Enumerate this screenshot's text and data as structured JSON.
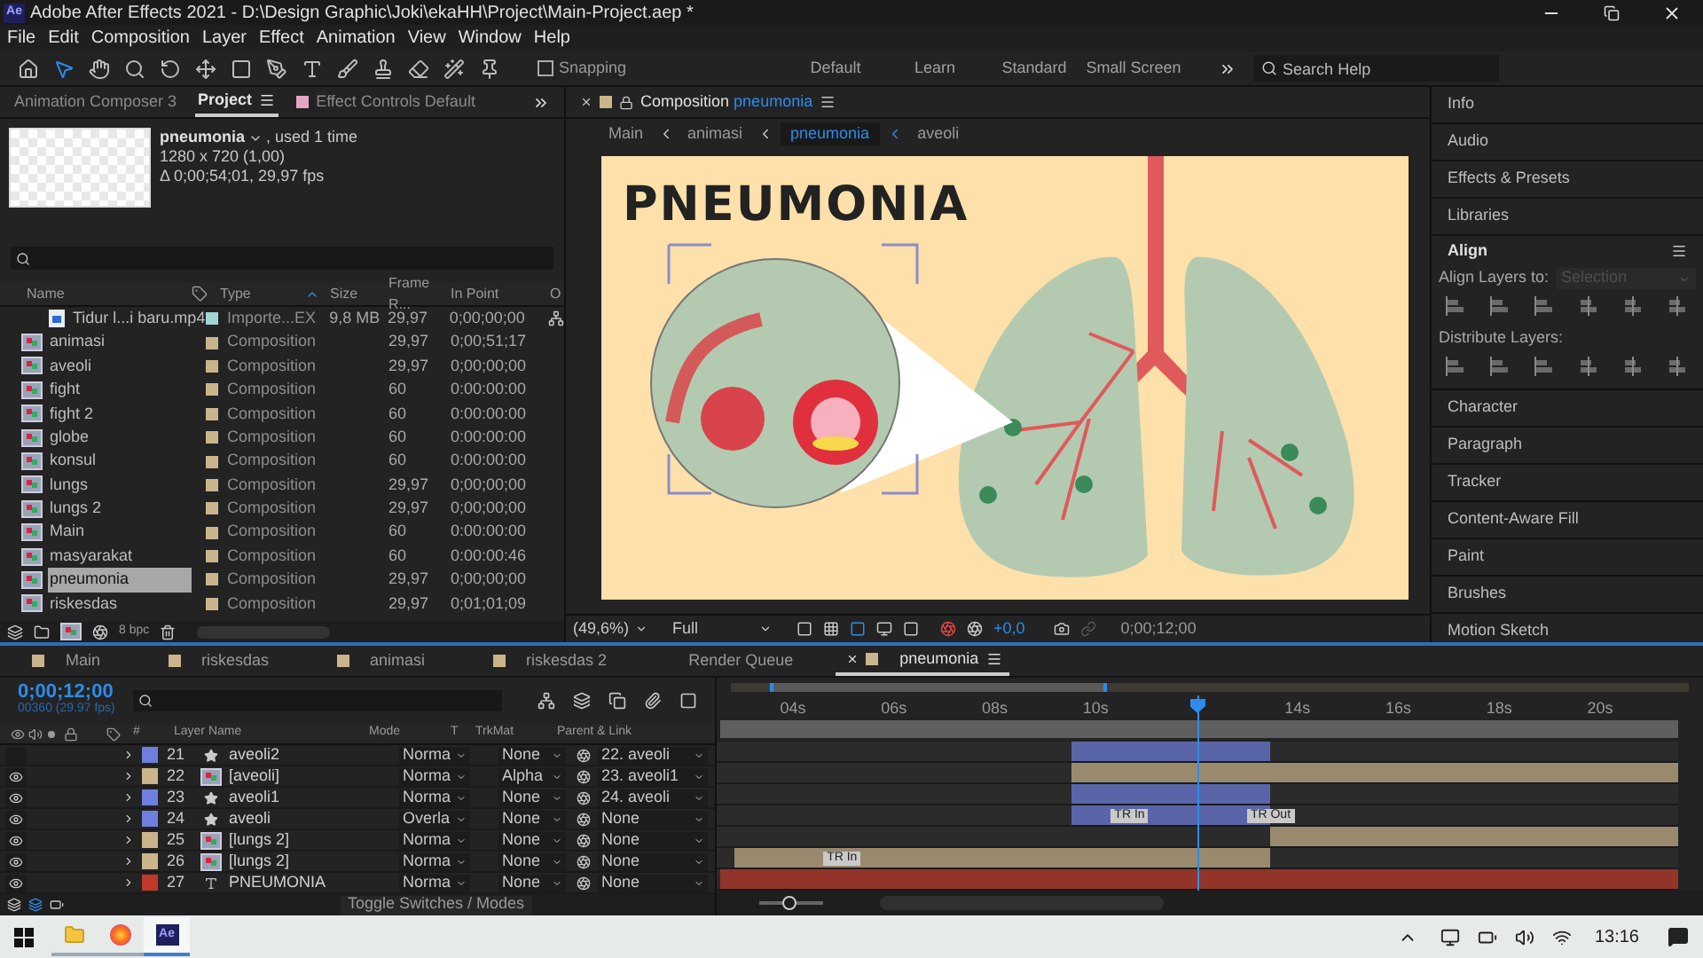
{
  "window": {
    "app_badge": "Ae",
    "title": "Adobe After Effects 2021 - D:\\Design Graphic\\Joki\\ekaHH\\Project\\Main-Project.aep *"
  },
  "menu": [
    "File",
    "Edit",
    "Composition",
    "Layer",
    "Effect",
    "Animation",
    "View",
    "Window",
    "Help"
  ],
  "toolbar": {
    "tools": [
      {
        "kind": "home",
        "selected": false
      },
      {
        "kind": "select",
        "selected": true
      },
      {
        "kind": "hand",
        "selected": false
      },
      {
        "kind": "zoom",
        "selected": false
      },
      {
        "kind": "rotate",
        "selected": false
      },
      {
        "kind": "anchor",
        "selected": false
      },
      {
        "kind": "rect",
        "selected": false
      },
      {
        "kind": "pen",
        "selected": false
      },
      {
        "kind": "type",
        "selected": false
      },
      {
        "kind": "brush",
        "selected": false
      },
      {
        "kind": "stamp",
        "selected": false
      },
      {
        "kind": "eraser",
        "selected": false
      },
      {
        "kind": "roto",
        "selected": false
      },
      {
        "kind": "pin",
        "selected": false
      }
    ],
    "snapping": {
      "label": "Snapping",
      "checked": false
    },
    "workspaces": [
      {
        "label": "Default",
        "selected": false
      },
      {
        "label": "Learn",
        "selected": false
      },
      {
        "label": "Standard",
        "selected": false
      },
      {
        "label": "Small Screen",
        "selected": false
      }
    ],
    "search": {
      "placeholder": "Search Help"
    }
  },
  "left_tabs": [
    {
      "label": "Animation Composer 3",
      "selected": false
    },
    {
      "label": "Project",
      "selected": true
    },
    {
      "label": "Effect Controls Default",
      "selected": false
    }
  ],
  "project": {
    "item_name": "pneumonia",
    "usage": ", used 1 time",
    "dimensions": "1280 x 720 (1,00)",
    "duration": "Δ 0;00;54;01, 29,97 fps",
    "columns": [
      "Name",
      "Type",
      "Size",
      "Frame R...",
      "In Point",
      "O"
    ],
    "rows": [
      {
        "kind": "footage",
        "name": "Tidur l...i baru.mp4",
        "color": "#9fd6d0",
        "type": "Importe...EX",
        "size": "9,8 MB",
        "fps": "29,97",
        "in_point": "0;00;00;00",
        "selected": false,
        "flowchart": true
      },
      {
        "kind": "composition",
        "name": "animasi",
        "color": "#c9b48c",
        "type": "Composition",
        "fps": "29,97",
        "in_point": "0;00;51;17",
        "selected": false
      },
      {
        "kind": "composition",
        "name": "aveoli",
        "color": "#c9b48c",
        "type": "Composition",
        "fps": "29,97",
        "in_point": "0;00;00;00",
        "selected": false
      },
      {
        "kind": "composition",
        "name": "fight",
        "color": "#c9b48c",
        "type": "Composition",
        "fps": "60",
        "in_point": "0:00:00:00",
        "selected": false
      },
      {
        "kind": "composition",
        "name": "fight 2",
        "color": "#c9b48c",
        "type": "Composition",
        "fps": "60",
        "in_point": "0:00:00:00",
        "selected": false
      },
      {
        "kind": "composition",
        "name": "globe",
        "color": "#c9b48c",
        "type": "Composition",
        "fps": "60",
        "in_point": "0:00:00:00",
        "selected": false
      },
      {
        "kind": "composition",
        "name": "konsul",
        "color": "#c9b48c",
        "type": "Composition",
        "fps": "60",
        "in_point": "0:00:00:00",
        "selected": false
      },
      {
        "kind": "composition",
        "name": "lungs",
        "color": "#c9b48c",
        "type": "Composition",
        "fps": "29,97",
        "in_point": "0;00;00;00",
        "selected": false
      },
      {
        "kind": "composition",
        "name": "lungs 2",
        "color": "#c9b48c",
        "type": "Composition",
        "fps": "29,97",
        "in_point": "0;00;00;00",
        "selected": false
      },
      {
        "kind": "composition",
        "name": "Main",
        "color": "#c9b48c",
        "type": "Composition",
        "fps": "60",
        "in_point": "0:00:00:00",
        "selected": false
      },
      {
        "kind": "composition",
        "name": "masyarakat",
        "color": "#c9b48c",
        "type": "Composition",
        "fps": "60",
        "in_point": "0:00:00:46",
        "selected": false
      },
      {
        "kind": "composition",
        "name": "pneumonia",
        "color": "#c9b48c",
        "type": "Composition",
        "fps": "29,97",
        "in_point": "0;00;00;00",
        "selected": true
      },
      {
        "kind": "composition",
        "name": "riskesdas",
        "color": "#c9b48c",
        "type": "Composition",
        "fps": "29,97",
        "in_point": "0;01;01;09",
        "selected": false
      }
    ],
    "bpc": "8 bpc"
  },
  "composition": {
    "tab_label": "Composition",
    "comp_name": "pneumonia",
    "breadcrumbs": [
      {
        "label": "Main",
        "selected": false
      },
      {
        "label": "animasi",
        "selected": false
      },
      {
        "label": "pneumonia",
        "selected": true
      },
      {
        "label": "aveoli",
        "selected": false
      }
    ],
    "artwork_title": "PNEUMONIA",
    "zoom": "(49,6%)",
    "resolution": "Full",
    "exposure": "+0,0",
    "timecode": "0;00;12;00"
  },
  "right_panels": [
    {
      "kind": "tab",
      "label": "Info"
    },
    {
      "kind": "tab",
      "label": "Audio"
    },
    {
      "kind": "tab",
      "label": "Effects & Presets"
    },
    {
      "kind": "tab",
      "label": "Libraries"
    },
    {
      "kind": "align",
      "label": "Align",
      "layers_to_label": "Align Layers to:",
      "layers_to_value": "Selection",
      "distribute_label": "Distribute Layers:"
    },
    {
      "kind": "tab",
      "label": "Character"
    },
    {
      "kind": "tab",
      "label": "Paragraph"
    },
    {
      "kind": "tab",
      "label": "Tracker"
    },
    {
      "kind": "tab",
      "label": "Content-Aware Fill"
    },
    {
      "kind": "tab",
      "label": "Paint"
    },
    {
      "kind": "tab",
      "label": "Brushes"
    },
    {
      "kind": "tab",
      "label": "Motion Sketch"
    }
  ],
  "timeline": {
    "tabs": [
      {
        "label": "Main",
        "color": "#c9b48c",
        "selected": false
      },
      {
        "label": "riskesdas",
        "color": "#c9b48c",
        "selected": false
      },
      {
        "label": "animasi",
        "color": "#c9b48c",
        "selected": false
      },
      {
        "label": "riskesdas 2",
        "color": "#c9b48c",
        "selected": false
      },
      {
        "label": "Render Queue",
        "selected": false
      },
      {
        "label": "pneumonia",
        "color": "#c9b48c",
        "selected": true
      }
    ],
    "timecode": "0;00;12;00",
    "frames": "00360 (29.97 fps)",
    "columns": [
      "#",
      "Layer Name",
      "Mode",
      "T",
      "TrkMat",
      "Parent & Link"
    ],
    "ticks": [
      "04s",
      "06s",
      "08s",
      "10s",
      "14s",
      "16s",
      "18s",
      "20s"
    ],
    "layers": [
      {
        "number": "21",
        "kind": "shape",
        "name": "aveoli2",
        "color": "#6f7fe0",
        "visible": false,
        "mode": "Norma",
        "trkmat": "None",
        "parent": "22. aveoli"
      },
      {
        "number": "22",
        "kind": "precomp",
        "name": "[aveoli]",
        "color": "#c9b48c",
        "visible": true,
        "mode": "Norma",
        "trkmat": "Alpha",
        "parent": "23. aveoli1"
      },
      {
        "number": "23",
        "kind": "shape",
        "name": "aveoli1",
        "color": "#6f7fe0",
        "visible": true,
        "mode": "Norma",
        "trkmat": "None",
        "parent": "24. aveoli"
      },
      {
        "number": "24",
        "kind": "shape",
        "name": "aveoli",
        "color": "#6f7fe0",
        "visible": true,
        "mode": "Overla",
        "trkmat": "None",
        "parent": "None",
        "markers": [
          "TR In",
          "TR Out"
        ]
      },
      {
        "number": "25",
        "kind": "precomp",
        "name": "[lungs 2]",
        "color": "#c9b48c",
        "visible": true,
        "mode": "Norma",
        "trkmat": "None",
        "parent": "None"
      },
      {
        "number": "26",
        "kind": "precomp",
        "name": "[lungs 2]",
        "color": "#c9b48c",
        "visible": true,
        "mode": "Norma",
        "trkmat": "None",
        "parent": "None",
        "markers": [
          "TR In"
        ]
      },
      {
        "number": "27",
        "kind": "text",
        "name": "PNEUMONIA",
        "color": "#c0392b",
        "visible": true,
        "mode": "Norma",
        "trkmat": "None",
        "parent": "None"
      }
    ],
    "footer": "Toggle Switches / Modes",
    "zoom_slider": {
      "level": 0.45
    }
  },
  "taskbar": {
    "apps": [
      {
        "kind": "explorer",
        "selected": false
      },
      {
        "kind": "firefox",
        "selected": false
      },
      {
        "kind": "aftereffects",
        "selected": true
      }
    ],
    "app_badge": "Ae",
    "clock": "13:16"
  }
}
